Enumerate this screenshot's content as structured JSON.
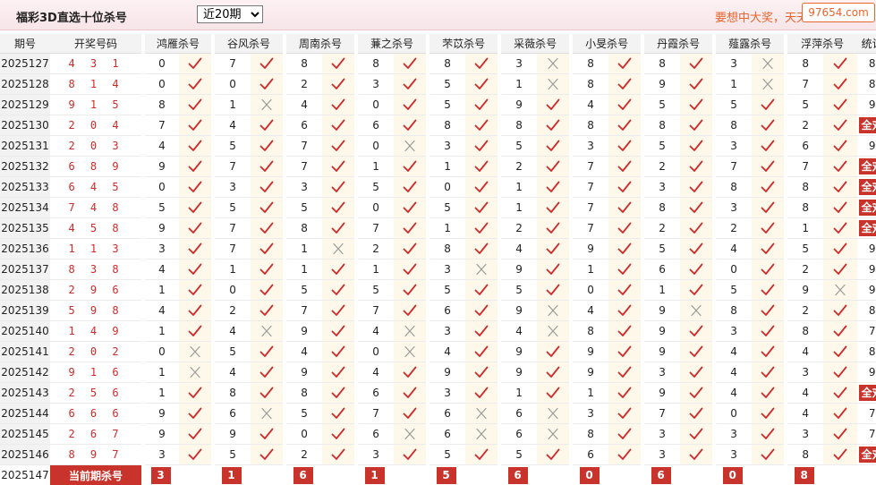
{
  "header": {
    "title": "福彩3D直选十位杀号",
    "period_select_value": "近20期",
    "period_select_options": [
      "近20期"
    ],
    "slogan": "要想中大奖，天天",
    "watermark": "97654.com"
  },
  "columns": {
    "issue": "期号",
    "draw": "开奖号码",
    "experts": [
      "鸿雁杀号",
      "谷风杀号",
      "周南杀号",
      "蒹之杀号",
      "芣苡杀号",
      "采薇杀号",
      "小旻杀号",
      "丹霞杀号",
      "薤露杀号",
      "浮萍杀号"
    ],
    "count": "统计"
  },
  "all_correct_label": "全对",
  "rows": [
    {
      "issue": "2025127",
      "draw": "4 3 1",
      "kills": [
        [
          0,
          1
        ],
        [
          7,
          1
        ],
        [
          8,
          1
        ],
        [
          8,
          1
        ],
        [
          8,
          1
        ],
        [
          3,
          0
        ],
        [
          8,
          1
        ],
        [
          8,
          1
        ],
        [
          3,
          0
        ],
        [
          8,
          1
        ]
      ],
      "count": "8"
    },
    {
      "issue": "2025128",
      "draw": "8 1 4",
      "kills": [
        [
          0,
          1
        ],
        [
          0,
          1
        ],
        [
          2,
          1
        ],
        [
          3,
          1
        ],
        [
          5,
          1
        ],
        [
          1,
          0
        ],
        [
          8,
          1
        ],
        [
          9,
          1
        ],
        [
          1,
          0
        ],
        [
          7,
          1
        ]
      ],
      "count": "8"
    },
    {
      "issue": "2025129",
      "draw": "9 1 5",
      "kills": [
        [
          8,
          1
        ],
        [
          1,
          0
        ],
        [
          4,
          1
        ],
        [
          0,
          1
        ],
        [
          5,
          1
        ],
        [
          9,
          1
        ],
        [
          4,
          1
        ],
        [
          5,
          1
        ],
        [
          5,
          1
        ],
        [
          5,
          1
        ]
      ],
      "count": "9"
    },
    {
      "issue": "2025130",
      "draw": "2 0 4",
      "kills": [
        [
          7,
          1
        ],
        [
          4,
          1
        ],
        [
          6,
          1
        ],
        [
          6,
          1
        ],
        [
          8,
          1
        ],
        [
          8,
          1
        ],
        [
          8,
          1
        ],
        [
          8,
          1
        ],
        [
          8,
          1
        ],
        [
          2,
          1
        ]
      ],
      "count": "全对"
    },
    {
      "issue": "2025131",
      "draw": "2 0 3",
      "kills": [
        [
          4,
          1
        ],
        [
          5,
          1
        ],
        [
          7,
          1
        ],
        [
          0,
          0
        ],
        [
          3,
          1
        ],
        [
          5,
          1
        ],
        [
          3,
          1
        ],
        [
          5,
          1
        ],
        [
          3,
          1
        ],
        [
          6,
          1
        ]
      ],
      "count": "9"
    },
    {
      "issue": "2025132",
      "draw": "6 8 9",
      "kills": [
        [
          9,
          1
        ],
        [
          7,
          1
        ],
        [
          7,
          1
        ],
        [
          1,
          1
        ],
        [
          1,
          1
        ],
        [
          2,
          1
        ],
        [
          7,
          1
        ],
        [
          2,
          1
        ],
        [
          7,
          1
        ],
        [
          7,
          1
        ]
      ],
      "count": "全对"
    },
    {
      "issue": "2025133",
      "draw": "6 4 5",
      "kills": [
        [
          0,
          1
        ],
        [
          3,
          1
        ],
        [
          3,
          1
        ],
        [
          5,
          1
        ],
        [
          0,
          1
        ],
        [
          1,
          1
        ],
        [
          7,
          1
        ],
        [
          3,
          1
        ],
        [
          8,
          1
        ],
        [
          8,
          1
        ]
      ],
      "count": "全对"
    },
    {
      "issue": "2025134",
      "draw": "7 4 8",
      "kills": [
        [
          5,
          1
        ],
        [
          5,
          1
        ],
        [
          5,
          1
        ],
        [
          0,
          1
        ],
        [
          5,
          1
        ],
        [
          1,
          1
        ],
        [
          7,
          1
        ],
        [
          8,
          1
        ],
        [
          3,
          1
        ],
        [
          8,
          1
        ]
      ],
      "count": "全对"
    },
    {
      "issue": "2025135",
      "draw": "4 5 8",
      "kills": [
        [
          9,
          1
        ],
        [
          7,
          1
        ],
        [
          8,
          1
        ],
        [
          7,
          1
        ],
        [
          1,
          1
        ],
        [
          2,
          1
        ],
        [
          7,
          1
        ],
        [
          2,
          1
        ],
        [
          2,
          1
        ],
        [
          1,
          1
        ]
      ],
      "count": "全对"
    },
    {
      "issue": "2025136",
      "draw": "1 1 3",
      "kills": [
        [
          3,
          1
        ],
        [
          7,
          1
        ],
        [
          1,
          0
        ],
        [
          2,
          1
        ],
        [
          8,
          1
        ],
        [
          4,
          1
        ],
        [
          9,
          1
        ],
        [
          5,
          1
        ],
        [
          4,
          1
        ],
        [
          5,
          1
        ]
      ],
      "count": "9"
    },
    {
      "issue": "2025137",
      "draw": "8 3 8",
      "kills": [
        [
          4,
          1
        ],
        [
          1,
          1
        ],
        [
          1,
          1
        ],
        [
          1,
          1
        ],
        [
          3,
          0
        ],
        [
          9,
          1
        ],
        [
          1,
          1
        ],
        [
          6,
          1
        ],
        [
          0,
          1
        ],
        [
          2,
          1
        ]
      ],
      "count": "9"
    },
    {
      "issue": "2025138",
      "draw": "2 9 6",
      "kills": [
        [
          1,
          1
        ],
        [
          0,
          1
        ],
        [
          5,
          1
        ],
        [
          5,
          1
        ],
        [
          5,
          1
        ],
        [
          5,
          1
        ],
        [
          0,
          1
        ],
        [
          1,
          1
        ],
        [
          5,
          1
        ],
        [
          9,
          0
        ]
      ],
      "count": "9"
    },
    {
      "issue": "2025139",
      "draw": "5 9 8",
      "kills": [
        [
          4,
          1
        ],
        [
          2,
          1
        ],
        [
          7,
          1
        ],
        [
          7,
          1
        ],
        [
          6,
          1
        ],
        [
          9,
          0
        ],
        [
          4,
          1
        ],
        [
          9,
          0
        ],
        [
          8,
          1
        ],
        [
          2,
          1
        ]
      ],
      "count": "8"
    },
    {
      "issue": "2025140",
      "draw": "1 4 9",
      "kills": [
        [
          1,
          1
        ],
        [
          4,
          0
        ],
        [
          9,
          1
        ],
        [
          4,
          0
        ],
        [
          3,
          1
        ],
        [
          4,
          0
        ],
        [
          8,
          1
        ],
        [
          9,
          1
        ],
        [
          3,
          1
        ],
        [
          8,
          1
        ]
      ],
      "count": "7"
    },
    {
      "issue": "2025141",
      "draw": "2 0 2",
      "kills": [
        [
          0,
          0
        ],
        [
          5,
          1
        ],
        [
          4,
          1
        ],
        [
          0,
          0
        ],
        [
          4,
          1
        ],
        [
          9,
          1
        ],
        [
          9,
          1
        ],
        [
          9,
          1
        ],
        [
          4,
          1
        ],
        [
          4,
          1
        ]
      ],
      "count": "8"
    },
    {
      "issue": "2025142",
      "draw": "9 1 6",
      "kills": [
        [
          1,
          0
        ],
        [
          4,
          1
        ],
        [
          9,
          1
        ],
        [
          4,
          1
        ],
        [
          9,
          1
        ],
        [
          9,
          1
        ],
        [
          9,
          1
        ],
        [
          3,
          1
        ],
        [
          4,
          1
        ],
        [
          3,
          1
        ]
      ],
      "count": "9"
    },
    {
      "issue": "2025143",
      "draw": "2 5 6",
      "kills": [
        [
          1,
          1
        ],
        [
          8,
          1
        ],
        [
          8,
          1
        ],
        [
          6,
          1
        ],
        [
          3,
          1
        ],
        [
          1,
          1
        ],
        [
          1,
          1
        ],
        [
          9,
          1
        ],
        [
          4,
          1
        ],
        [
          4,
          1
        ]
      ],
      "count": "全对"
    },
    {
      "issue": "2025144",
      "draw": "6 6 6",
      "kills": [
        [
          9,
          1
        ],
        [
          6,
          0
        ],
        [
          5,
          1
        ],
        [
          7,
          1
        ],
        [
          6,
          0
        ],
        [
          6,
          0
        ],
        [
          3,
          1
        ],
        [
          7,
          1
        ],
        [
          0,
          1
        ],
        [
          4,
          1
        ]
      ],
      "count": "7"
    },
    {
      "issue": "2025145",
      "draw": "2 6 7",
      "kills": [
        [
          9,
          1
        ],
        [
          9,
          1
        ],
        [
          0,
          1
        ],
        [
          6,
          0
        ],
        [
          6,
          0
        ],
        [
          6,
          0
        ],
        [
          8,
          1
        ],
        [
          3,
          1
        ],
        [
          3,
          1
        ],
        [
          3,
          1
        ]
      ],
      "count": "7"
    },
    {
      "issue": "2025146",
      "draw": "8 9 7",
      "kills": [
        [
          3,
          1
        ],
        [
          5,
          1
        ],
        [
          2,
          1
        ],
        [
          3,
          1
        ],
        [
          5,
          1
        ],
        [
          5,
          1
        ],
        [
          6,
          1
        ],
        [
          3,
          1
        ],
        [
          3,
          1
        ],
        [
          8,
          1
        ]
      ],
      "count": "全对"
    }
  ],
  "current": {
    "issue": "2025147",
    "label": "当前期杀号",
    "kills": [
      "3",
      "1",
      "6",
      "1",
      "5",
      "6",
      "0",
      "6",
      "0",
      "8"
    ]
  }
}
